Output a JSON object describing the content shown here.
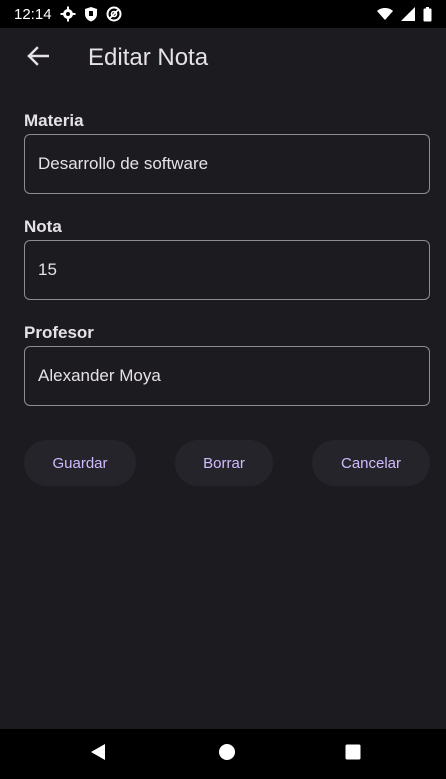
{
  "status_bar": {
    "time": "12:14",
    "left_icons": [
      "gear-icon",
      "shield-icon",
      "vpn-icon"
    ],
    "right_icons": [
      "wifi-icon",
      "signal-icon",
      "battery-icon"
    ]
  },
  "app_bar": {
    "title": "Editar Nota",
    "back_icon": "arrow-left-icon"
  },
  "form": {
    "materia": {
      "label": "Materia",
      "value": "Desarrollo de software"
    },
    "nota": {
      "label": "Nota",
      "value": "15"
    },
    "profesor": {
      "label": "Profesor",
      "value": "Alexander Moya"
    }
  },
  "buttons": {
    "save_label": "Guardar",
    "delete_label": "Borrar",
    "cancel_label": "Cancelar"
  },
  "nav_bar": {
    "icons": [
      "nav-back-icon",
      "nav-home-icon",
      "nav-recents-icon"
    ]
  },
  "colors": {
    "background": "#1c1b20",
    "accent_text": "#cfbcff",
    "button_bg": "#26242b",
    "field_border": "#8f8a93"
  }
}
